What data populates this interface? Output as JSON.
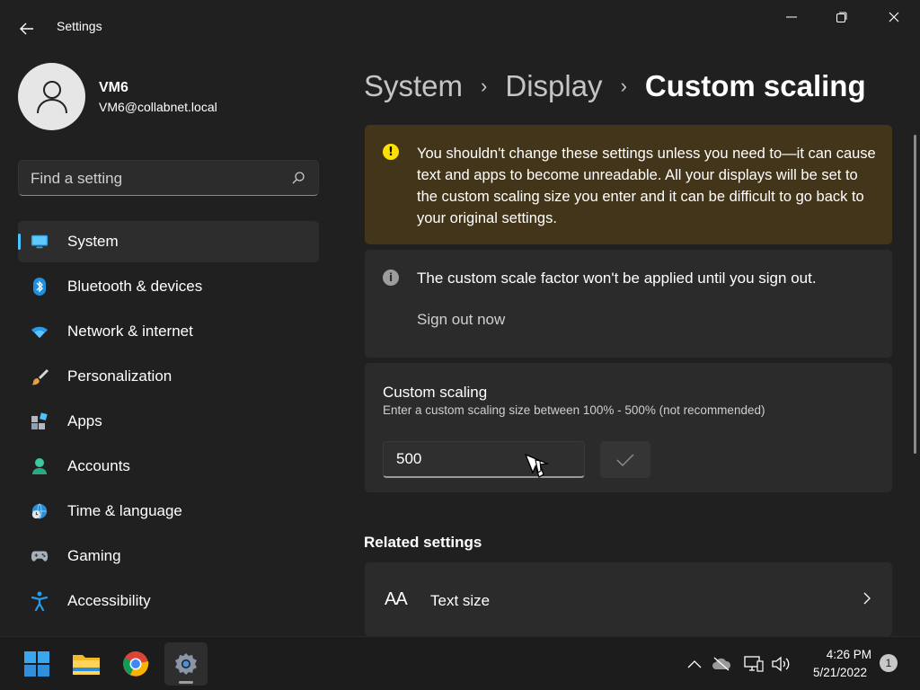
{
  "window": {
    "title": "Settings"
  },
  "profile": {
    "name": "VM6",
    "email": "VM6@collabnet.local"
  },
  "search": {
    "placeholder": "Find a setting"
  },
  "sidebar": {
    "items": [
      {
        "label": "System",
        "icon": "monitor-icon",
        "active": true
      },
      {
        "label": "Bluetooth & devices",
        "icon": "bluetooth-icon"
      },
      {
        "label": "Network & internet",
        "icon": "wifi-icon"
      },
      {
        "label": "Personalization",
        "icon": "brush-icon"
      },
      {
        "label": "Apps",
        "icon": "apps-icon"
      },
      {
        "label": "Accounts",
        "icon": "person-icon"
      },
      {
        "label": "Time & language",
        "icon": "globe-clock-icon"
      },
      {
        "label": "Gaming",
        "icon": "gamepad-icon"
      },
      {
        "label": "Accessibility",
        "icon": "accessibility-icon"
      }
    ]
  },
  "breadcrumb": {
    "items": [
      "System",
      "Display"
    ],
    "current": "Custom scaling"
  },
  "warning": {
    "text": "You shouldn't change these settings unless you need to—it can cause text and apps to become unreadable. All your displays will be set to the custom scaling size you enter and it can be difficult to go back to your original settings."
  },
  "info": {
    "text": "The custom scale factor won't be applied until you sign out.",
    "signout_label": "Sign out now"
  },
  "custom_scaling": {
    "title": "Custom scaling",
    "description": "Enter a custom scaling size between 100% - 500% (not recommended)",
    "value": "500"
  },
  "related": {
    "heading": "Related settings",
    "items": [
      {
        "icon_text": "AA",
        "label": "Text size"
      }
    ]
  },
  "taskbar": {
    "apps": [
      "start-icon",
      "file-explorer-icon",
      "chrome-icon",
      "settings-icon"
    ],
    "time": "4:26 PM",
    "date": "5/21/2022",
    "notification_count": "1"
  },
  "colors": {
    "accent": "#4cc2ff",
    "warning_bg": "#433519",
    "card_bg": "#2b2b2b",
    "background": "#202020"
  }
}
